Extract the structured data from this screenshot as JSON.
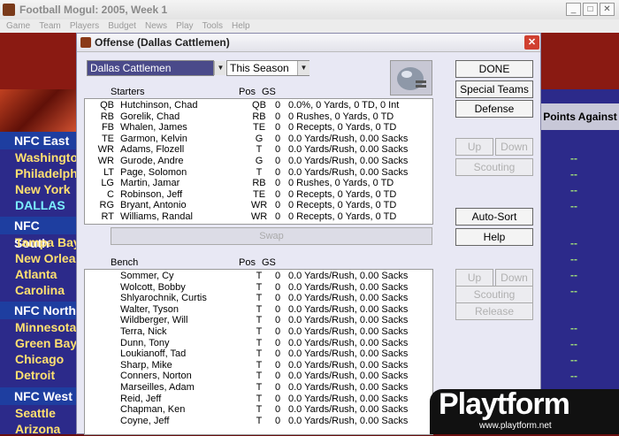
{
  "window": {
    "title": "Football Mogul: 2005, Week 1",
    "menu": [
      "Game",
      "Team",
      "Players",
      "Budget",
      "News",
      "Play",
      "Tools",
      "Help"
    ]
  },
  "background": {
    "divisions": [
      {
        "name": "NFC East",
        "teams": [
          "Washington",
          "Philadelphia",
          "New York",
          "DALLAS"
        ],
        "highlight": "DALLAS"
      },
      {
        "name": "NFC South",
        "teams": [
          "Tampa Bay",
          "New Orleans",
          "Atlanta",
          "Carolina"
        ]
      },
      {
        "name": "NFC North",
        "teams": [
          "Minnesota",
          "Green Bay",
          "Chicago",
          "Detroit"
        ]
      },
      {
        "name": "NFC West",
        "teams": [
          "Seattle",
          "Arizona"
        ]
      }
    ],
    "points_against_header": "Points Against",
    "points_placeholder": "--"
  },
  "dialog": {
    "title": "Offense (Dallas Cattlemen)",
    "team_select": "Dallas Cattlemen",
    "season_select": "This Season",
    "starters_header": {
      "label": "Starters",
      "pos": "Pos",
      "gs": "GS"
    },
    "bench_header": {
      "label": "Bench",
      "pos": "Pos",
      "gs": "GS"
    },
    "starters": [
      {
        "slot": "QB",
        "name": "Hutchinson, Chad",
        "pos": "QB",
        "gs": "0",
        "stats": "0.0%, 0 Yards, 0 TD, 0 Int"
      },
      {
        "slot": "RB",
        "name": "Gorelik, Chad",
        "pos": "RB",
        "gs": "0",
        "stats": "0 Rushes, 0 Yards, 0 TD"
      },
      {
        "slot": "FB",
        "name": "Whalen, James",
        "pos": "TE",
        "gs": "0",
        "stats": "0 Recepts, 0 Yards, 0 TD"
      },
      {
        "slot": "TE",
        "name": "Garmon, Kelvin",
        "pos": "G",
        "gs": "0",
        "stats": "0.0 Yards/Rush, 0.00 Sacks"
      },
      {
        "slot": "WR",
        "name": "Adams, Flozell",
        "pos": "T",
        "gs": "0",
        "stats": "0.0 Yards/Rush, 0.00 Sacks"
      },
      {
        "slot": "WR",
        "name": "Gurode, Andre",
        "pos": "G",
        "gs": "0",
        "stats": "0.0 Yards/Rush, 0.00 Sacks"
      },
      {
        "slot": "LT",
        "name": "Page, Solomon",
        "pos": "T",
        "gs": "0",
        "stats": "0.0 Yards/Rush, 0.00 Sacks"
      },
      {
        "slot": "LG",
        "name": "Martin, Jamar",
        "pos": "RB",
        "gs": "0",
        "stats": "0 Rushes, 0 Yards, 0 TD"
      },
      {
        "slot": "C",
        "name": "Robinson, Jeff",
        "pos": "TE",
        "gs": "0",
        "stats": "0 Recepts, 0 Yards, 0 TD"
      },
      {
        "slot": "RG",
        "name": "Bryant, Antonio",
        "pos": "WR",
        "gs": "0",
        "stats": "0 Recepts, 0 Yards, 0 TD"
      },
      {
        "slot": "RT",
        "name": "Williams, Randal",
        "pos": "WR",
        "gs": "0",
        "stats": "0 Recepts, 0 Yards, 0 TD"
      }
    ],
    "bench": [
      {
        "name": "Sommer, Cy",
        "pos": "T",
        "gs": "0",
        "stats": "0.0 Yards/Rush, 0.00 Sacks"
      },
      {
        "name": "Wolcott, Bobby",
        "pos": "T",
        "gs": "0",
        "stats": "0.0 Yards/Rush, 0.00 Sacks"
      },
      {
        "name": "Shlyarochnik, Curtis",
        "pos": "T",
        "gs": "0",
        "stats": "0.0 Yards/Rush, 0.00 Sacks"
      },
      {
        "name": "Walter, Tyson",
        "pos": "T",
        "gs": "0",
        "stats": "0.0 Yards/Rush, 0.00 Sacks"
      },
      {
        "name": "Wildberger, Will",
        "pos": "T",
        "gs": "0",
        "stats": "0.0 Yards/Rush, 0.00 Sacks"
      },
      {
        "name": "Terra, Nick",
        "pos": "T",
        "gs": "0",
        "stats": "0.0 Yards/Rush, 0.00 Sacks"
      },
      {
        "name": "Dunn, Tony",
        "pos": "T",
        "gs": "0",
        "stats": "0.0 Yards/Rush, 0.00 Sacks"
      },
      {
        "name": "Loukianoff, Tad",
        "pos": "T",
        "gs": "0",
        "stats": "0.0 Yards/Rush, 0.00 Sacks"
      },
      {
        "name": "Sharp, Mike",
        "pos": "T",
        "gs": "0",
        "stats": "0.0 Yards/Rush, 0.00 Sacks"
      },
      {
        "name": "Conners, Norton",
        "pos": "T",
        "gs": "0",
        "stats": "0.0 Yards/Rush, 0.00 Sacks"
      },
      {
        "name": "Marseilles, Adam",
        "pos": "T",
        "gs": "0",
        "stats": "0.0 Yards/Rush, 0.00 Sacks"
      },
      {
        "name": "Reid, Jeff",
        "pos": "T",
        "gs": "0",
        "stats": "0.0 Yards/Rush, 0.00 Sacks"
      },
      {
        "name": "Chapman, Ken",
        "pos": "T",
        "gs": "0",
        "stats": "0.0 Yards/Rush, 0.00 Sacks"
      },
      {
        "name": "Coyne, Jeff",
        "pos": "T",
        "gs": "0",
        "stats": "0.0 Yards/Rush, 0.00 Sacks"
      }
    ],
    "buttons": {
      "done": "DONE",
      "special_teams": "Special Teams",
      "defense": "Defense",
      "up": "Up",
      "down": "Down",
      "scouting": "Scouting",
      "auto_sort": "Auto-Sort",
      "help": "Help",
      "swap": "Swap",
      "release": "Release"
    }
  },
  "watermark": {
    "brand": "Playtform",
    "url": "www.playtform.net"
  }
}
